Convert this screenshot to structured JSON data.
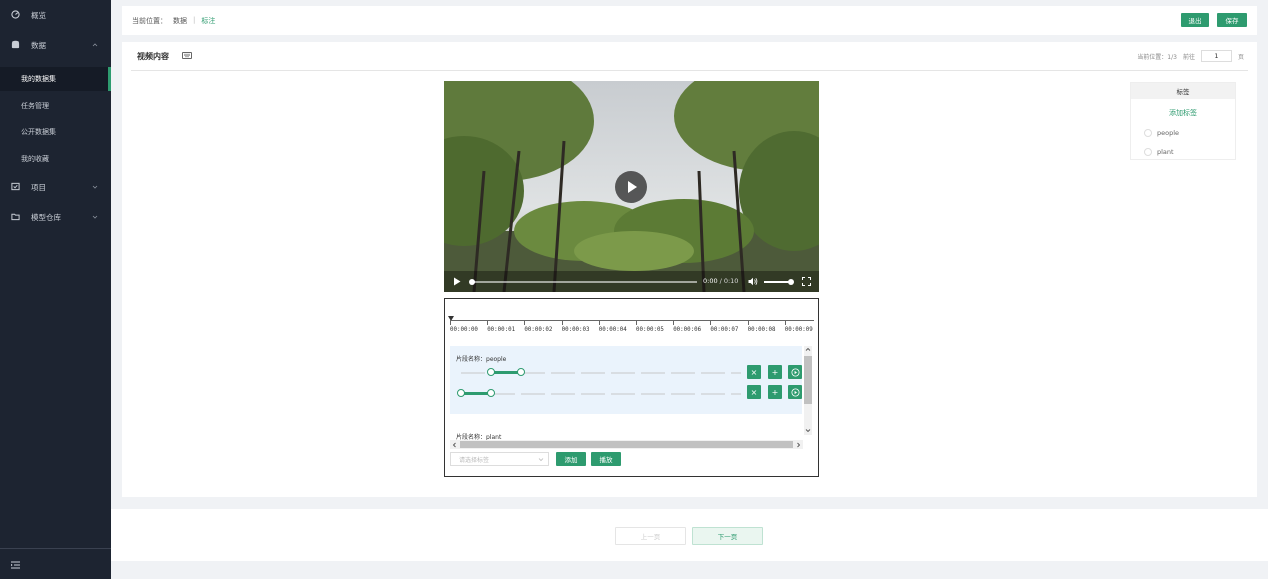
{
  "sidebar": {
    "items": [
      {
        "label": "概览"
      },
      {
        "label": "数据"
      },
      {
        "label": "项目"
      },
      {
        "label": "模型仓库"
      }
    ],
    "sub_items": [
      {
        "label": "我的数据集"
      },
      {
        "label": "任务管理"
      },
      {
        "label": "公开数据集"
      },
      {
        "label": "我的收藏"
      }
    ]
  },
  "breadcrumb": {
    "prefix": "当前位置：",
    "level1": "数据",
    "separator": "|",
    "current": "标注"
  },
  "toolbar": {
    "exit_label": "退出",
    "save_label": "保存"
  },
  "panel": {
    "title": "视频内容",
    "position_label": "当前位置：1/3",
    "goto_label": "前往",
    "page_value": "1",
    "page_suffix": "页"
  },
  "video": {
    "current_time": "0:00",
    "separator": "/",
    "duration": "0:10",
    "progress": 0.0,
    "volume": 0.9
  },
  "timeline": {
    "ticks": [
      "00:00:00",
      "00:00:01",
      "00:00:02",
      "00:00:03",
      "00:00:04",
      "00:00:05",
      "00:00:06",
      "00:00:07",
      "00:00:08",
      "00:00:09"
    ],
    "segments": [
      {
        "name_label": "片段名称：",
        "name": "people"
      },
      {
        "name_label": "片段名称：",
        "name": "plant"
      }
    ],
    "select_placeholder": "请选择标签",
    "add_label": "添加",
    "play_label": "播放"
  },
  "tags": {
    "title": "标签",
    "add_label": "添加标签",
    "items": [
      "people",
      "plant"
    ]
  },
  "pager": {
    "prev_label": "上一页",
    "next_label": "下一页"
  },
  "colors": {
    "accent": "#2e9b6f",
    "sidebar_bg": "#1d2431",
    "segment_bg": "#eaf3fc"
  }
}
